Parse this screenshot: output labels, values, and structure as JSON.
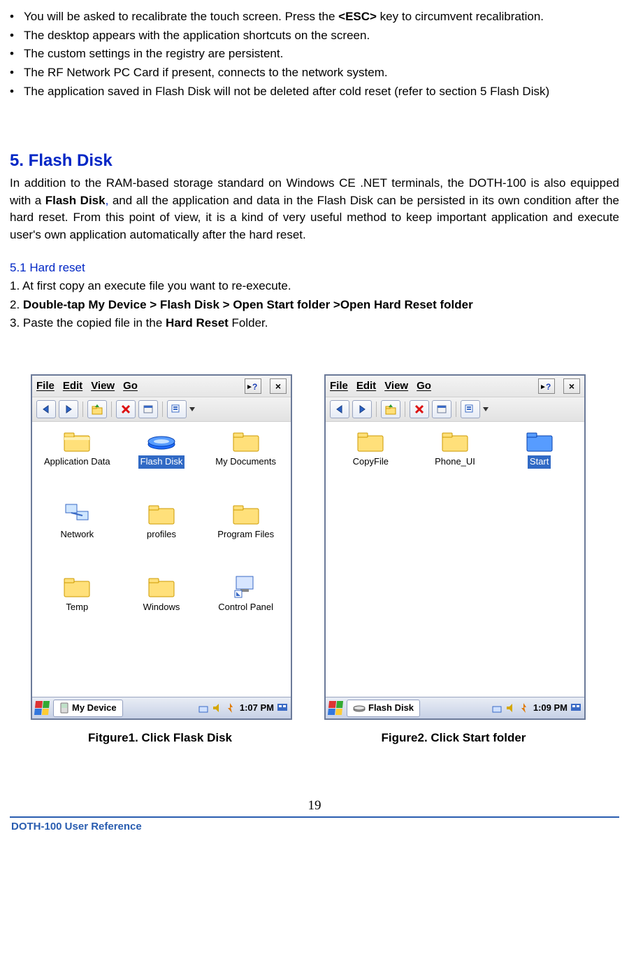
{
  "bullets": {
    "b1a": "You will be asked to recalibrate the touch screen. Press the ",
    "b1k": "<ESC>",
    "b1b": " key to circumvent recalibration.",
    "b2": "The desktop appears with the application shortcuts on the screen.",
    "b3": "The custom settings in the registry are persistent.",
    "b4": "The RF Network PC Card if present, connects to the network system.",
    "b5": "The application saved in Flash Disk will not be deleted after cold reset (refer to section 5 Flash Disk)"
  },
  "section": {
    "title": "5. Flash Disk",
    "body_a": "In addition to the RAM-based storage standard on Windows CE .NET terminals, the DOTH-100 is also equipped with a ",
    "body_bold": "Flash Disk",
    "body_comma": ",",
    "body_b": " and all the application and data in the Flash Disk can be persisted in its own condition after the hard reset. From this point of view, it is a kind of very useful method to keep important application and execute user's own application automatically after the hard reset.",
    "sub": "5.1 Hard reset",
    "s1": "1. At first copy an execute file you want to re-execute.",
    "s2a": "2. ",
    "s2b": "Double-tap My Device > Flash Disk > Open Start folder >Open Hard Reset folder",
    "s3a": "3. Paste the copied file in the ",
    "s3b": "Hard Reset",
    "s3c": " Folder."
  },
  "menu": {
    "file": "File",
    "edit": "Edit",
    "view": "View",
    "go": "Go",
    "close": "×",
    "help": "?"
  },
  "fig1": {
    "items": [
      "Application Data",
      "Flash Disk",
      "My Documents",
      "Network",
      "profiles",
      "Program Files",
      "Temp",
      "Windows",
      "Control Panel"
    ],
    "taskbar": "My Device",
    "time": "1:07 PM",
    "caption": "Fitgure1. Click Flask Disk"
  },
  "fig2": {
    "items": [
      "CopyFile",
      "Phone_UI",
      "Start"
    ],
    "taskbar": "Flash Disk",
    "time": "1:09 PM",
    "caption": "Figure2. Click Start folder"
  },
  "page_number": "19",
  "footer": "DOTH-100 User Reference"
}
